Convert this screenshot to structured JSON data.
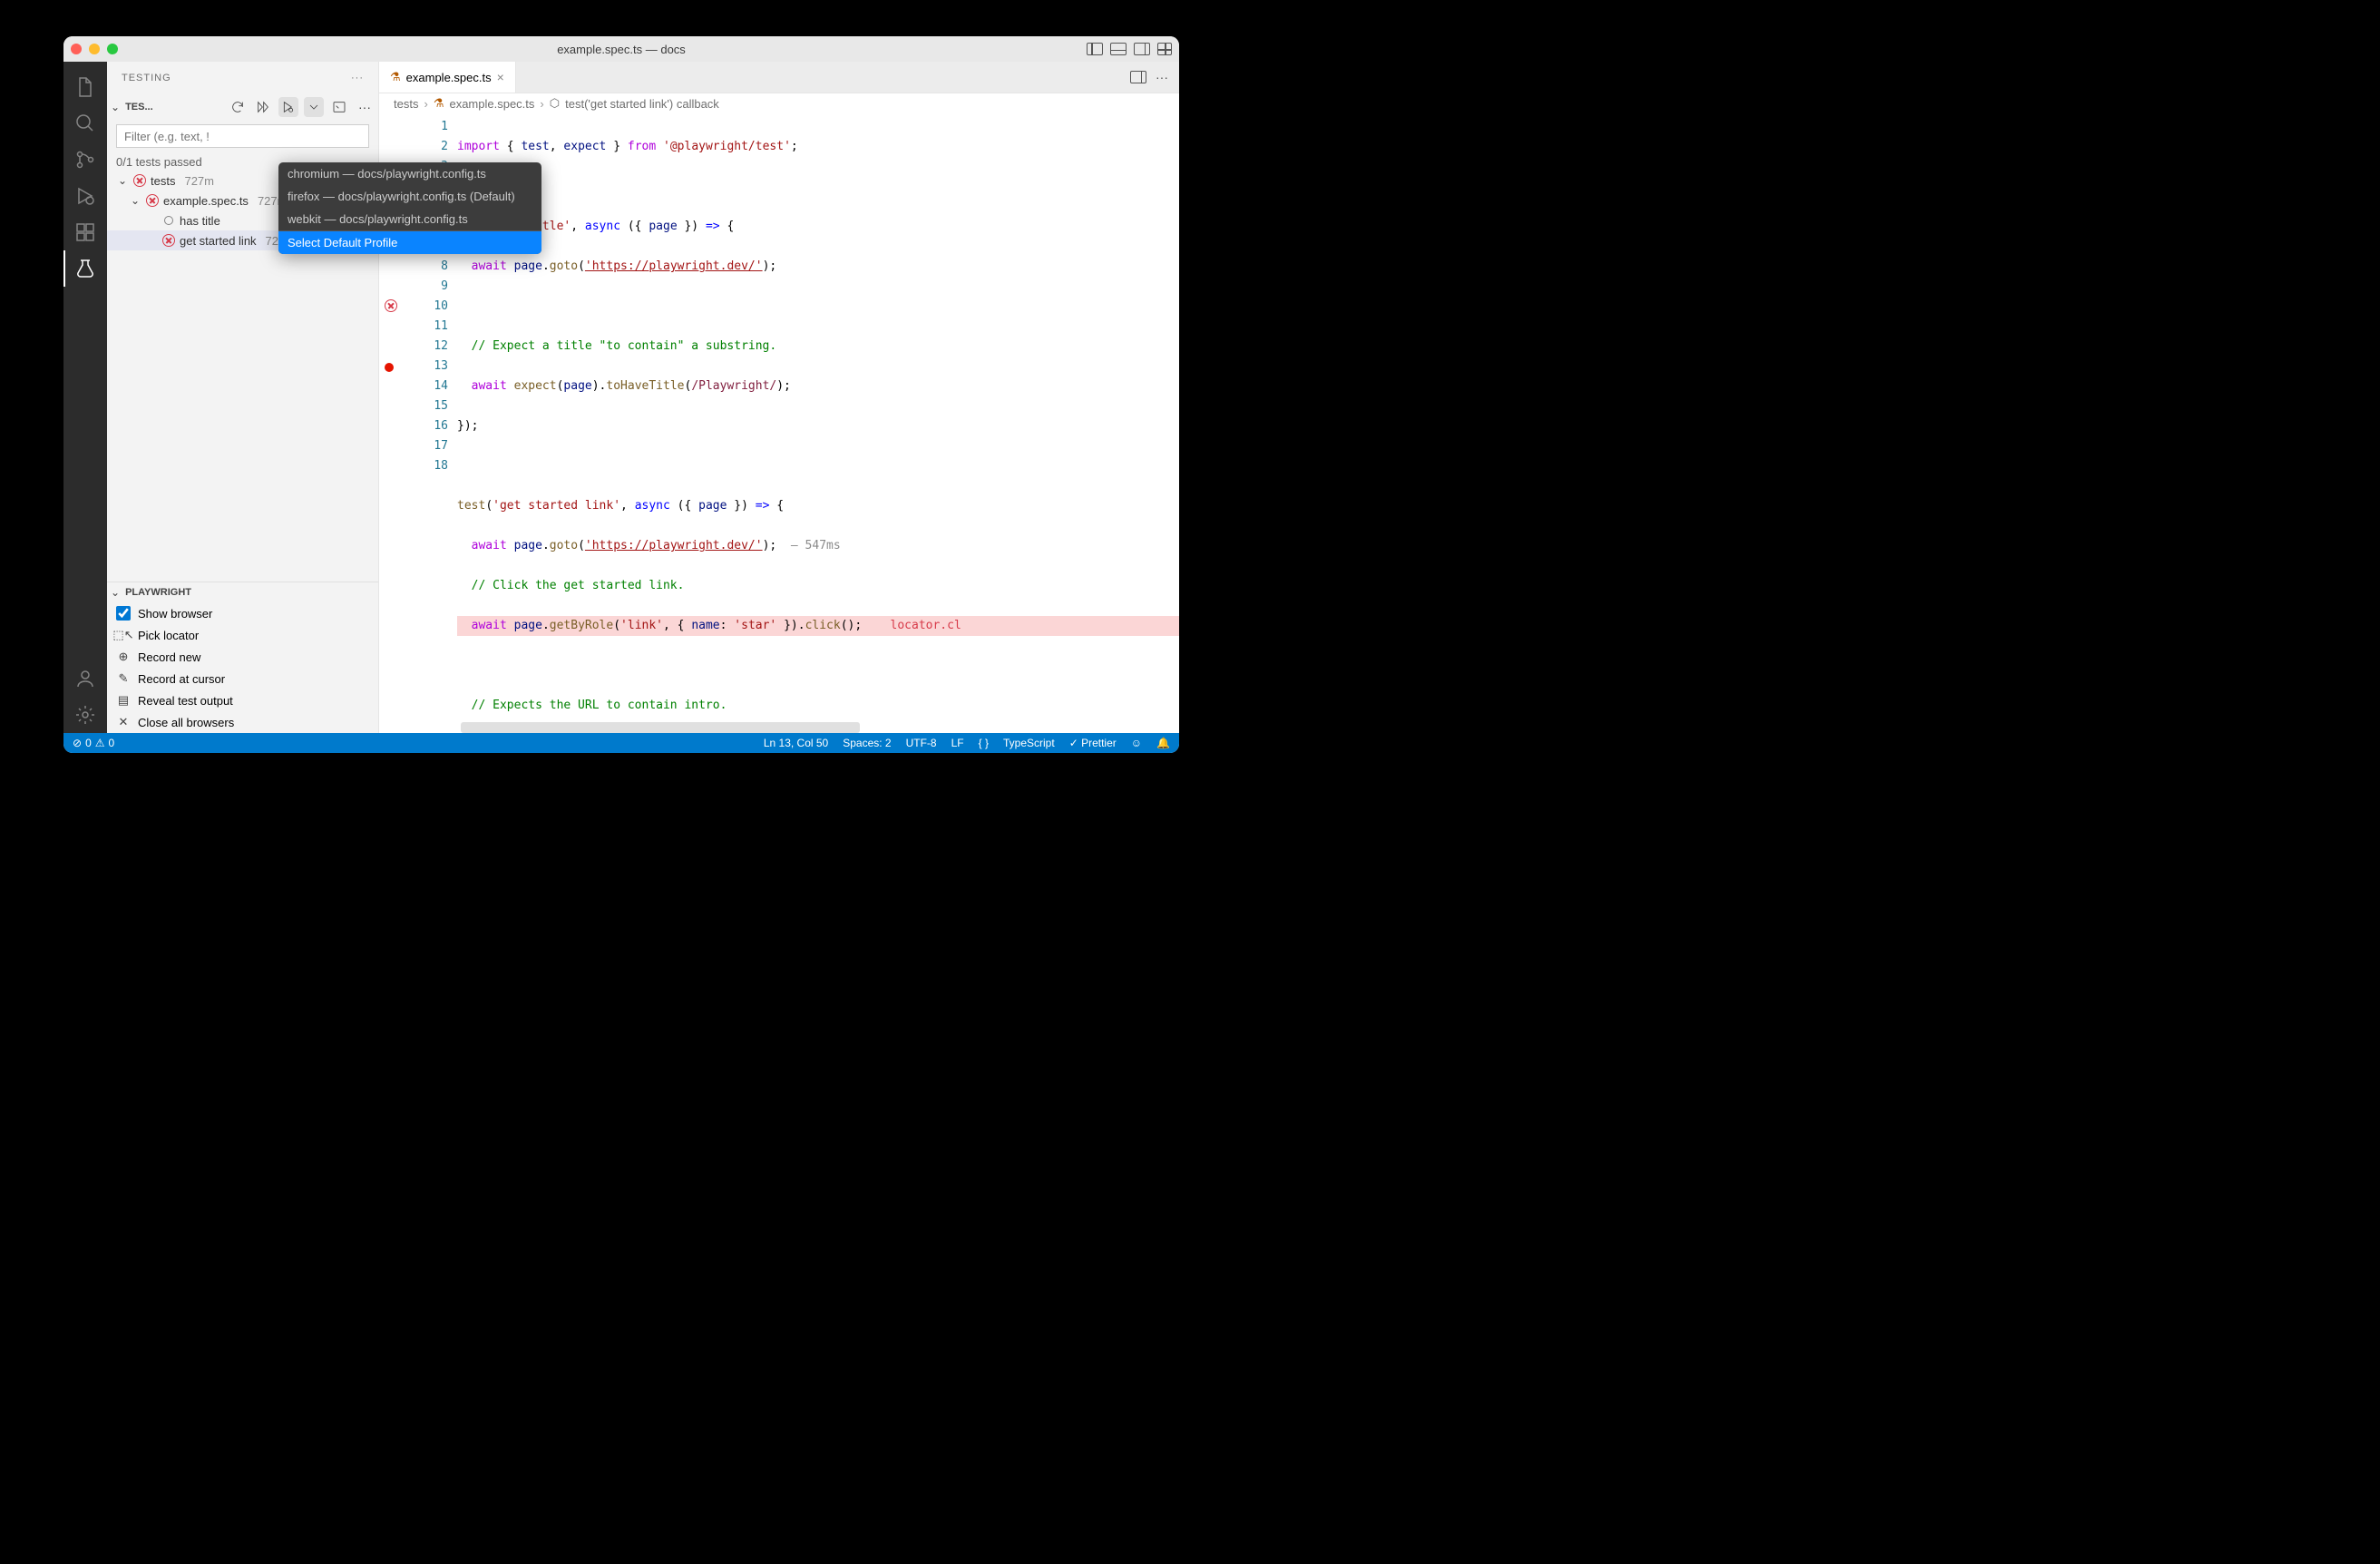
{
  "title": "example.spec.ts — docs",
  "sidebar": {
    "header": "TESTING",
    "section_label": "TES...",
    "filter_placeholder": "Filter (e.g. text, !",
    "status": "0/1 tests passed",
    "tree": [
      {
        "label": "tests",
        "time": "727m",
        "status": "error",
        "indent": 0,
        "expanded": true
      },
      {
        "label": "example.spec.ts",
        "time": "727ms",
        "status": "error",
        "indent": 1,
        "expanded": true
      },
      {
        "label": "has title",
        "time": "",
        "status": "circle",
        "indent": 2
      },
      {
        "label": "get started link",
        "time": "727ms",
        "status": "error",
        "indent": 2,
        "selected": true
      }
    ]
  },
  "dropdown": {
    "items": [
      "chromium — docs/playwright.config.ts",
      "firefox — docs/playwright.config.ts (Default)",
      "webkit — docs/playwright.config.ts"
    ],
    "action": "Select Default Profile"
  },
  "playwright": {
    "header": "PLAYWRIGHT",
    "items": [
      {
        "type": "check",
        "label": "Show browser",
        "checked": true
      },
      {
        "type": "pick",
        "label": "Pick locator"
      },
      {
        "type": "record",
        "label": "Record new"
      },
      {
        "type": "cursor",
        "label": "Record at cursor"
      },
      {
        "type": "reveal",
        "label": "Reveal test output"
      },
      {
        "type": "close",
        "label": "Close all browsers"
      }
    ]
  },
  "tab": {
    "name": "example.spec.ts"
  },
  "breadcrumb": [
    "tests",
    "example.spec.ts",
    "test('get started link') callback"
  ],
  "lines": {
    "start": 1,
    "hints": {
      "11": "— 547ms",
      "13": "locator.cl"
    }
  },
  "statusbar": {
    "errors": "0",
    "warnings": "0",
    "ln": "Ln 13, Col 50",
    "spaces": "Spaces: 2",
    "enc": "UTF-8",
    "eol": "LF",
    "lang": "TypeScript",
    "fmt": "Prettier"
  }
}
